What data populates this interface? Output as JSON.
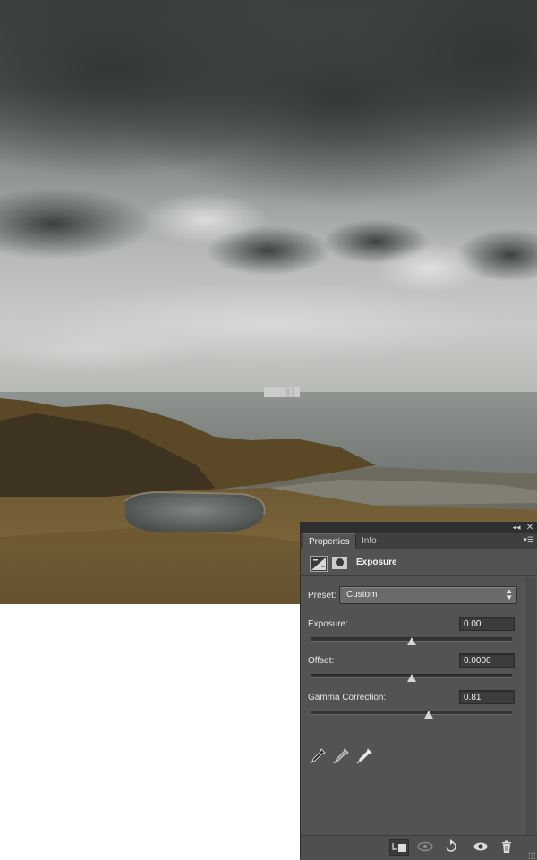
{
  "panel": {
    "tabs": [
      {
        "label": "Properties",
        "active": true
      },
      {
        "label": "Info",
        "active": false
      }
    ],
    "adjustment_title": "Exposure",
    "preset": {
      "label": "Preset:",
      "value": "Custom"
    },
    "controls": {
      "exposure": {
        "label": "Exposure:",
        "value": "0.00",
        "slider_fraction": 0.5
      },
      "offset": {
        "label": "Offset:",
        "value": "0.0000",
        "slider_fraction": 0.5
      },
      "gamma": {
        "label": "Gamma Correction:",
        "value": "0.81",
        "slider_fraction": 0.585
      }
    },
    "eyedroppers": [
      "black-point-eyedropper-icon",
      "gray-point-eyedropper-icon",
      "white-point-eyedropper-icon"
    ],
    "footer_buttons": [
      "clip-to-layer-icon",
      "view-previous-state-icon",
      "reset-icon",
      "visibility-icon",
      "delete-icon"
    ],
    "colors": {
      "panel_bg": "#535353",
      "tab_bar": "#3f3f3f",
      "field_bg": "#3c3c3c"
    }
  }
}
